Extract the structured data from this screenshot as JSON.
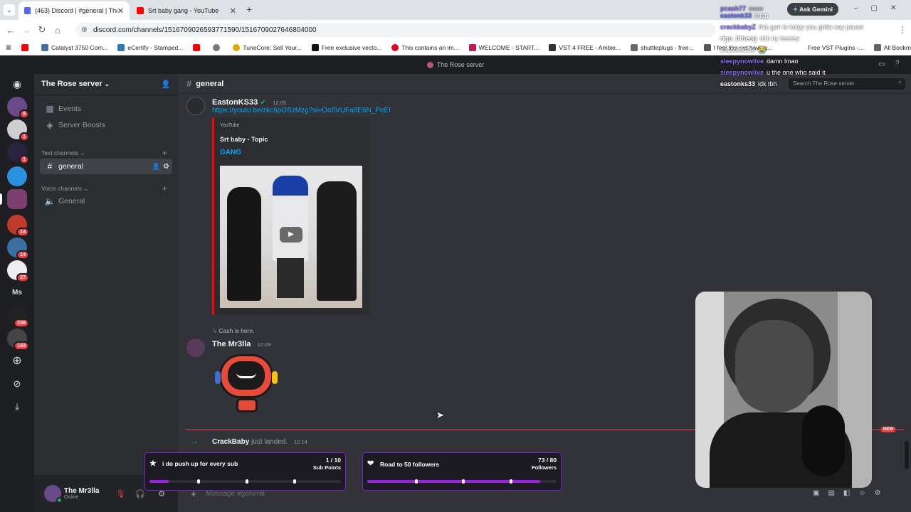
{
  "browser": {
    "tabs": [
      {
        "label": "(463) Discord | #general | The R",
        "active": true,
        "icon": "discord-icon"
      },
      {
        "label": "Srt baby gang - YouTube",
        "active": false,
        "icon": "youtube-icon"
      }
    ],
    "url": "discord.com/channels/1516709026593771590/1516709027646804000",
    "bookmarks": [
      "Catalyst 3750 Com...",
      "eCertify - Stamped...",
      "TuneCore: Sell Your...",
      "Free exclusive vecto...",
      "This contains an im...",
      "WELCOME - START...",
      "VST 4 FREE - Ambie...",
      "shuttleplugs - free...",
      "I feel like not having...",
      "Free VST Plugins -...",
      "All Bookmarks"
    ],
    "ask_gemini": "Ask Gemini"
  },
  "discord": {
    "window_title": "The Rose server",
    "server_name": "The Rose server",
    "sidebar": {
      "items": [
        "Events",
        "Server Boosts"
      ],
      "text_category": "Text channels",
      "text_channels": [
        "general"
      ],
      "voice_category": "Voice channels",
      "voice_channels": [
        "General"
      ]
    },
    "server_badges": [
      "6",
      "1",
      "1",
      "14",
      "14",
      "27",
      "238",
      "162"
    ],
    "server_ms_label": "Ms",
    "channel": "general",
    "search_placeholder": "Search The Rose server",
    "messages": {
      "m1": {
        "author": "EastonKS33",
        "time": "12:05",
        "link": "https://youtu.be/zkc6pOSzMzg?si=Oo5VUFa8E6N_PeEI",
        "embed_provider": "YouTube",
        "embed_author": "Srt baby - Topic",
        "embed_title": "GANG"
      },
      "m2": {
        "reply_text": "Cash is here.",
        "author": "The Mr3lla",
        "time": "12:09"
      },
      "m3": {
        "author": "CrackBaby",
        "text": "just landed.",
        "time": "12:14"
      },
      "new_label": "NEW"
    },
    "input_placeholder": "Message #general",
    "user": {
      "name": "The Mr3lla",
      "status": "Online"
    }
  },
  "stream_overlay": {
    "widget1": {
      "label": "i do push up for every sub",
      "count": "1 / 10",
      "unit": "Sub Points",
      "progress": 0.1
    },
    "widget2": {
      "label": "Road to 50 followers",
      "count": "73 / 80",
      "unit": "Followers",
      "progress": 0.9125
    },
    "chat": [
      {
        "user": "pcash77",
        "text": "oooo"
      },
      {
        "user": "eastonk33",
        "text": "lmao"
      },
      {
        "user": "crackbabyZ",
        "text": "this geri is fuityy you gotta say pause"
      },
      {
        "user": "rigo_0theog",
        "text": "d1k by teezey"
      },
      {
        "user": "eastonks33",
        "text": "😭"
      },
      {
        "user": "sleepynowlive",
        "text": "damn lmao"
      },
      {
        "user": "sleepynowlive",
        "text": "u the one who said it"
      },
      {
        "user": "eastonks33",
        "text": "idk tbh"
      }
    ]
  },
  "colors": {
    "blurple": "#5865f2",
    "online": "#23a55a",
    "youtube": "#ff0000",
    "overlay_purple": "#9c1fe6"
  }
}
